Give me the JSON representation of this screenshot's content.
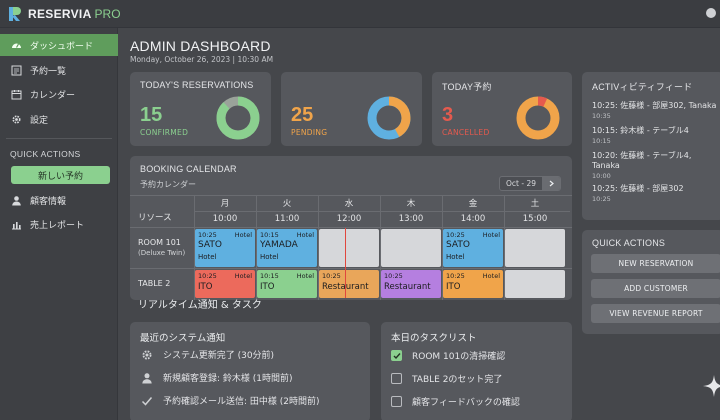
{
  "app": {
    "brand": "RESERVIA",
    "edition": "PRO"
  },
  "sidebar": {
    "items": [
      {
        "label": "ダッシュボード",
        "icon": "dashboard-icon",
        "active": true
      },
      {
        "label": "予約一覧",
        "icon": "list-icon"
      },
      {
        "label": "カレンダー",
        "icon": "calendar-icon"
      },
      {
        "label": "設定",
        "icon": "gear-icon"
      }
    ],
    "quick_actions_heading": "QUICK ACTIONS",
    "new_reservation": "新しい予約",
    "links": [
      {
        "label": "顧客情報",
        "icon": "user-icon"
      },
      {
        "label": "売上レポート",
        "icon": "bar-chart-icon"
      }
    ]
  },
  "header": {
    "title": "ADMIN DASHBOARD",
    "date": "Monday, October 26, 2023 | 10:30 AM"
  },
  "kpis": [
    {
      "title": "TODAY'S RESERVATIONS",
      "value": "15",
      "label": "CONFIRMED",
      "color": "#8bd08f",
      "ratio": 0.88
    },
    {
      "title": "",
      "value": "25",
      "label": "PENDING",
      "color": "#f0a44a",
      "ratio": 0.42
    },
    {
      "title": "TODAY予約",
      "value": "3",
      "label": "CANCELLED",
      "color": "#e55a4e",
      "ratio": 0.07
    }
  ],
  "calendar": {
    "title": "BOOKING CALENDAR",
    "subtitle": "予約カレンダー",
    "range": "Oct - 29",
    "resource_header": "リソース",
    "days": [
      "月",
      "火",
      "水",
      "木",
      "金",
      "土"
    ],
    "times": [
      "10:00",
      "11:00",
      "12:00",
      "13:00",
      "14:00",
      "15:00"
    ],
    "rows": [
      {
        "name": "ROOM 101",
        "sub": "(Deluxe Twin)"
      },
      {
        "name": "TABLE 2",
        "sub": ""
      }
    ],
    "bookings": [
      {
        "row": 0,
        "col": 0,
        "time": "10:25",
        "kind": "Hotel",
        "name": "SATO",
        "sub": "Hotel",
        "color": "#5fb0e0"
      },
      {
        "row": 0,
        "col": 1,
        "time": "10:15",
        "kind": "Hotel",
        "name": "YAMADA",
        "sub": "Hotel",
        "color": "#5fb0e0"
      },
      {
        "row": 0,
        "col": 4,
        "time": "10:25",
        "kind": "Hotel",
        "name": "SATO",
        "sub": "Hotel",
        "color": "#5fb0e0"
      },
      {
        "row": 1,
        "col": 0,
        "time": "10:25",
        "kind": "Hotel",
        "name": "ITO",
        "sub": "",
        "color": "#ec6a5c"
      },
      {
        "row": 1,
        "col": 1,
        "time": "10:15",
        "kind": "Hotel",
        "name": "ITO",
        "sub": "",
        "color": "#8bd08f"
      },
      {
        "row": 1,
        "col": 2,
        "time": "10:25",
        "kind": "",
        "name": "Restaurant",
        "sub": "",
        "color": "#e9a65a"
      },
      {
        "row": 1,
        "col": 3,
        "time": "10:25",
        "kind": "",
        "name": "Restaurant",
        "sub": "",
        "color": "#b57fe0"
      },
      {
        "row": 1,
        "col": 4,
        "time": "10:25",
        "kind": "Hotel",
        "name": "ITO",
        "sub": "",
        "color": "#f0a44a"
      }
    ]
  },
  "realtime_title": "リアルタイム通知 & タスク",
  "notifications": {
    "title": "最近のシステム通知",
    "items": [
      {
        "text": "システム更新完了 (30分前)",
        "icon": "gear-icon"
      },
      {
        "text": "新規顧客登録: 鈴木様 (1時間前)",
        "icon": "user-icon"
      },
      {
        "text": "予約確認メール送信: 田中様 (2時間前)",
        "icon": "check-icon"
      }
    ]
  },
  "tasks": {
    "title": "本日のタスクリスト",
    "items": [
      {
        "text": "ROOM 101の清掃確認",
        "checked": true
      },
      {
        "text": "TABLE 2のセット完了",
        "checked": false
      },
      {
        "text": "顧客フィードバックの確認",
        "checked": false
      }
    ]
  },
  "activity": {
    "title": "ACTIVィビティフィード",
    "items": [
      {
        "text": "10:25: 佐藤様 - 部屋302, Tanaka",
        "time": "10:35"
      },
      {
        "text": "10:15: 鈴木様 - テーブル4",
        "time": "10:15"
      },
      {
        "text": "10:20: 佐藤様 - テーブル4, Tanaka",
        "time": "10:00"
      },
      {
        "text": "10:25: 佐藤様 - 部屋302",
        "time": "10:25"
      }
    ]
  },
  "quick_actions": {
    "title": "QUICK ACTIONS",
    "buttons": [
      "NEW RESERVATION",
      "ADD CUSTOMER",
      "VIEW REVENUE REPORT"
    ]
  }
}
